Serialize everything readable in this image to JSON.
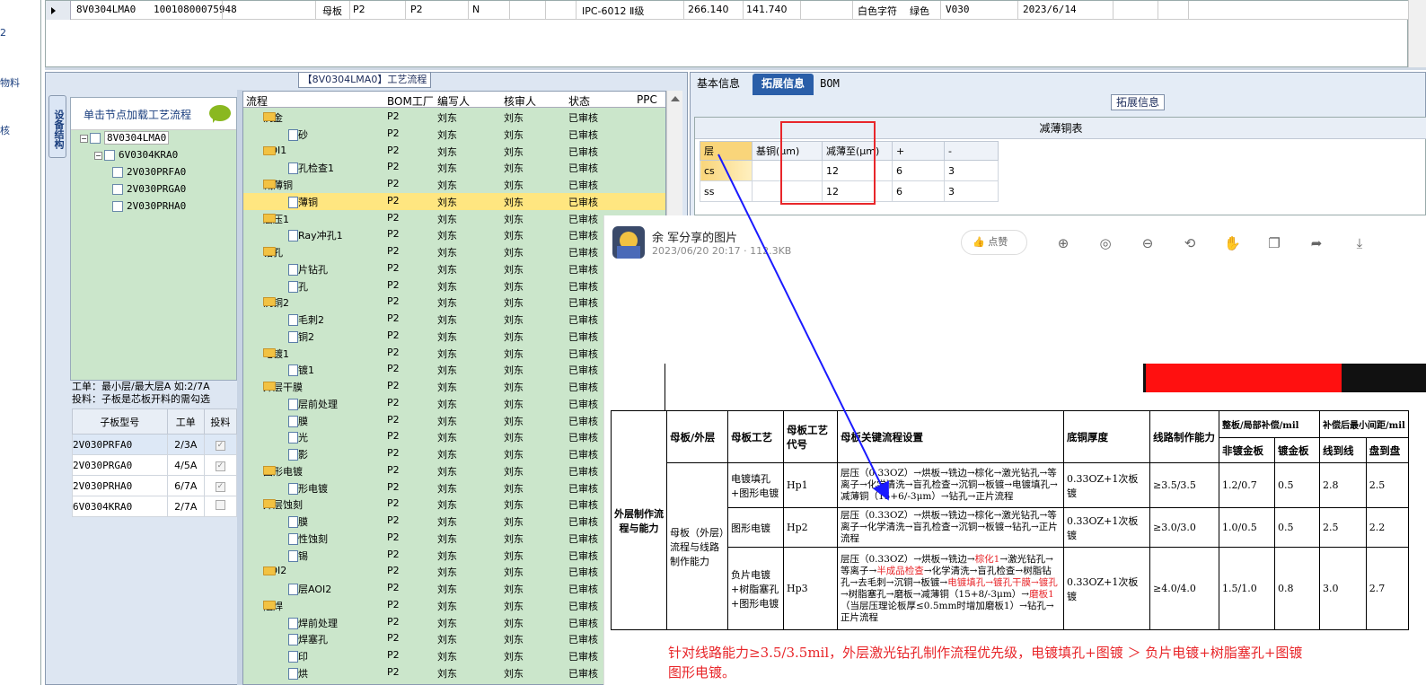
{
  "left_strip": {
    "items": [
      "2",
      "物料",
      "核"
    ]
  },
  "top_row": {
    "cells": [
      "8V0304LMA0",
      "10010800075948",
      "母板",
      "P2",
      "P2",
      "N",
      "IPC-6012 Ⅱ级",
      "266.140",
      "141.740",
      "白色字符",
      "绿色",
      "V030",
      "2023/6/14"
    ]
  },
  "process_panel": {
    "title": "【8V0304LMA0】工艺流程",
    "side_tab": "设备结构",
    "tree_hint": "单击节点加载工艺流程",
    "tree": [
      "8V0304LMA0",
      "6V0304KRA0",
      "2V030PRFA0",
      "2V030PRGA0",
      "2V030PRHA0"
    ],
    "note_line1": "工单：最小层/最大层A 如:2/7A",
    "note_line2": "投料：子板是芯板开料的需勾选",
    "sub_headers": [
      "子板型号",
      "工单",
      "投料"
    ],
    "sub_rows": [
      {
        "model": "2V030PRFA0",
        "order": "2/3A",
        "checked": true
      },
      {
        "model": "2V030PRGA0",
        "order": "4/5A",
        "checked": true
      },
      {
        "model": "2V030PRHA0",
        "order": "6/7A",
        "checked": true
      },
      {
        "model": "6V0304KRA0",
        "order": "2/7A",
        "checked": false
      }
    ]
  },
  "flow": {
    "headers": [
      "流程",
      "BOM工厂",
      "编写人",
      "核审人",
      "状态",
      "PPC"
    ],
    "rows": [
      {
        "level": 0,
        "name": "沉金",
        "f": "P2",
        "w": "刘东",
        "r": "刘东",
        "s": "已审核"
      },
      {
        "level": 1,
        "name": "喷砂",
        "f": "P2",
        "w": "刘东",
        "r": "刘东",
        "s": "已审核"
      },
      {
        "level": 0,
        "name": "AOI1",
        "f": "P2",
        "w": "刘东",
        "r": "刘东",
        "s": "已审核"
      },
      {
        "level": 1,
        "name": "盲孔检查1",
        "f": "P2",
        "w": "刘东",
        "r": "刘东",
        "s": "已审核"
      },
      {
        "level": 0,
        "name": "减薄铜",
        "f": "P2",
        "w": "刘东",
        "r": "刘东",
        "s": "已审核"
      },
      {
        "level": 1,
        "name": "减薄铜",
        "f": "P2",
        "w": "刘东",
        "r": "刘东",
        "s": "已审核",
        "selected": true
      },
      {
        "level": 0,
        "name": "层压1",
        "f": "P2",
        "w": "刘东",
        "r": "刘东",
        "s": "已审核"
      },
      {
        "level": 1,
        "name": "X-Ray冲孔1",
        "f": "P2",
        "w": "刘东",
        "r": "刘东",
        "s": "已审核"
      },
      {
        "level": 0,
        "name": "钻孔",
        "f": "P2",
        "w": "刘东",
        "r": "刘东",
        "s": "已审核"
      },
      {
        "level": 1,
        "name": "铝片钻孔",
        "f": "P2",
        "w": "刘东",
        "r": "刘东",
        "s": "已审核"
      },
      {
        "level": 1,
        "name": "钻孔",
        "f": "P2",
        "w": "刘东",
        "r": "刘东",
        "s": "已审核"
      },
      {
        "level": 0,
        "name": "沉铜2",
        "f": "P2",
        "w": "刘东",
        "r": "刘东",
        "s": "已审核"
      },
      {
        "level": 1,
        "name": "去毛刺2",
        "f": "P2",
        "w": "刘东",
        "r": "刘东",
        "s": "已审核"
      },
      {
        "level": 1,
        "name": "沉铜2",
        "f": "P2",
        "w": "刘东",
        "r": "刘东",
        "s": "已审核"
      },
      {
        "level": 0,
        "name": "电镀1",
        "f": "P2",
        "w": "刘东",
        "r": "刘东",
        "s": "已审核"
      },
      {
        "level": 1,
        "name": "板镀1",
        "f": "P2",
        "w": "刘东",
        "r": "刘东",
        "s": "已审核"
      },
      {
        "level": 0,
        "name": "外层干膜",
        "f": "P2",
        "w": "刘东",
        "r": "刘东",
        "s": "已审核"
      },
      {
        "level": 1,
        "name": "外层前处理",
        "f": "P2",
        "w": "刘东",
        "r": "刘东",
        "s": "已审核"
      },
      {
        "level": 1,
        "name": "贴膜",
        "f": "P2",
        "w": "刘东",
        "r": "刘东",
        "s": "已审核"
      },
      {
        "level": 1,
        "name": "曝光",
        "f": "P2",
        "w": "刘东",
        "r": "刘东",
        "s": "已审核"
      },
      {
        "level": 1,
        "name": "显影",
        "f": "P2",
        "w": "刘东",
        "r": "刘东",
        "s": "已审核"
      },
      {
        "level": 0,
        "name": "图形电镀",
        "f": "P2",
        "w": "刘东",
        "r": "刘东",
        "s": "已审核"
      },
      {
        "level": 1,
        "name": "图形电镀",
        "f": "P2",
        "w": "刘东",
        "r": "刘东",
        "s": "已审核"
      },
      {
        "level": 0,
        "name": "外层蚀刻",
        "f": "P2",
        "w": "刘东",
        "r": "刘东",
        "s": "已审核"
      },
      {
        "level": 1,
        "name": "退膜",
        "f": "P2",
        "w": "刘东",
        "r": "刘东",
        "s": "已审核"
      },
      {
        "level": 1,
        "name": "碱性蚀刻",
        "f": "P2",
        "w": "刘东",
        "r": "刘东",
        "s": "已审核"
      },
      {
        "level": 1,
        "name": "退锡",
        "f": "P2",
        "w": "刘东",
        "r": "刘东",
        "s": "已审核"
      },
      {
        "level": 0,
        "name": "AOI2",
        "f": "P2",
        "w": "刘东",
        "r": "刘东",
        "s": "已审核"
      },
      {
        "level": 1,
        "name": "外层AOI2",
        "f": "P2",
        "w": "刘东",
        "r": "刘东",
        "s": "已审核"
      },
      {
        "level": 0,
        "name": "阻焊",
        "f": "P2",
        "w": "刘东",
        "r": "刘东",
        "s": "已审核"
      },
      {
        "level": 1,
        "name": "阻焊前处理",
        "f": "P2",
        "w": "刘东",
        "r": "刘东",
        "s": "已审核"
      },
      {
        "level": 1,
        "name": "阻焊塞孔",
        "f": "P2",
        "w": "刘东",
        "r": "刘东",
        "s": "已审核"
      },
      {
        "level": 1,
        "name": "丝印",
        "f": "P2",
        "w": "刘东",
        "r": "刘东",
        "s": "已审核"
      },
      {
        "level": 1,
        "name": "预烘",
        "f": "P2",
        "w": "刘东",
        "r": "刘东",
        "s": "已审核"
      }
    ]
  },
  "right_panel": {
    "tabs": [
      "基本信息",
      "拓展信息",
      "BOM"
    ],
    "ext_label": "拓展信息",
    "table_title": "减薄铜表",
    "table_headers": [
      "层",
      "基铜(μm)",
      "减薄至(μm)",
      "+",
      "-"
    ],
    "table_rows": [
      [
        "cs",
        "",
        "12",
        "6",
        "3"
      ],
      [
        "ss",
        "",
        "12",
        "6",
        "3"
      ]
    ]
  },
  "chat": {
    "name": "余 军分享的图片",
    "meta": "2023/06/20 20:17 · 112.3KB",
    "like": "点赞",
    "icons": [
      "zoom-in-icon",
      "fit-icon",
      "zoom-out-icon",
      "rotate-icon",
      "hand-icon",
      "copy-icon",
      "share-icon",
      "download-icon"
    ]
  },
  "doc": {
    "side_label": "外层制作流程与能力",
    "head": [
      "母板/外层",
      "母板工艺",
      "母板工艺代号",
      "母板关键流程设置",
      "底铜厚度",
      "线路制作能力",
      "整板/局部补偿/mil",
      "补偿后最小间距/mil"
    ],
    "sub_head": [
      "非镀金板",
      "镀金板",
      "线到线",
      "盘到盘"
    ],
    "group_label": "母板（外层）流程与线路制作能力",
    "rows": [
      {
        "craft": "电镀填孔+图形电镀",
        "code": "Hp1",
        "flow": "层压（0.33OZ）→烘板→铣边→棕化→激光钻孔→等离子→化学清洗→盲孔检查→沉铜→板镀→电镀填孔→减薄铜（15+6/-3μm）→钻孔→正片流程",
        "cu": "0.33OZ+1次板镀",
        "cap": "≥3.5/3.5",
        "c1": "1.2/0.7",
        "c2": "0.5",
        "c3": "2.8",
        "c4": "2.5"
      },
      {
        "craft": "图形电镀",
        "code": "Hp2",
        "flow": "层压（0.33OZ）→烘板→铣边→棕化→激光钻孔→等离子→化学清洗→盲孔检查→沉铜→板镀→钻孔→正片流程",
        "cu": "0.33OZ+1次板镀",
        "cap": "≥3.0/3.0",
        "c1": "1.0/0.5",
        "c2": "0.5",
        "c3": "2.5",
        "c4": "2.2"
      },
      {
        "craft": "负片电镀+树脂塞孔+图形电镀",
        "code": "Hp3",
        "flow_a": "层压（0.33OZ）→烘板→铣边→",
        "flow_red1": "棕化1",
        "flow_b": "→激光钻孔→等离子→",
        "flow_red2": "半成品检查",
        "flow_c": "→化学清洗→盲孔检查→树脂钻孔→去毛刺→沉铜→板镀→",
        "flow_red3": "电镀填孔→镀孔干膜→镀孔",
        "flow_d": "→树脂塞孔→磨板→减薄铜（15+8/-3μm）→",
        "flow_red4": "磨板1",
        "flow_e": "（当层压理论板厚≤0.5mm时增加磨板1）→钻孔→正片流程",
        "cu": "0.33OZ+1次板镀",
        "cap": "≥4.0/4.0",
        "c1": "1.5/1.0",
        "c2": "0.8",
        "c3": "3.0",
        "c4": "2.7"
      }
    ],
    "bottom_note_1": "针对线路能力≥3.5/3.5mil，外层激光钻孔制作流程优先级，电镀填孔+图镀 ＞ 负片电镀+树脂塞孔+图镀",
    "bottom_note_2": "图形电镀。"
  }
}
